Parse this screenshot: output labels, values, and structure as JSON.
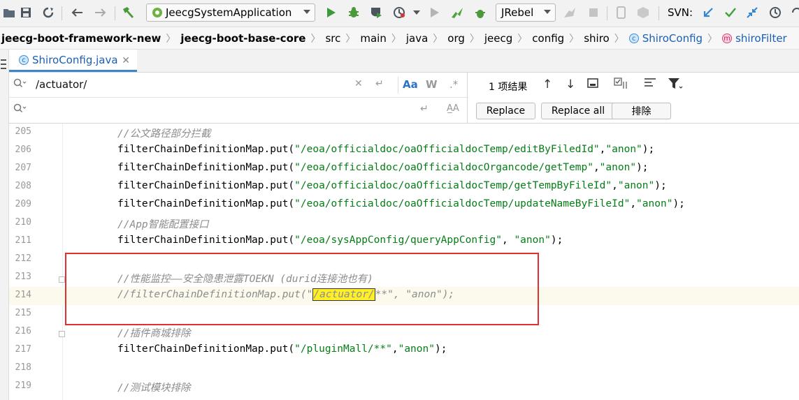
{
  "toolbar": {
    "run_config": "JeecgSystemApplication",
    "jrebel": "JRebel",
    "svn_label": "SVN:"
  },
  "breadcrumb": [
    "jeecg-boot-framework-new",
    "jeecg-boot-base-core",
    "src",
    "main",
    "java",
    "org",
    "jeecg",
    "config",
    "shiro",
    "ShiroConfig",
    "shiroFilter"
  ],
  "tab": {
    "label": "ShiroConfig.java"
  },
  "find": {
    "search_value": "/actuator/",
    "replace_value": "",
    "match_case": "Aa",
    "words": "W",
    "regex": ".*",
    "preserve_case": "A̲A",
    "result_count": "1 项结果",
    "replace_btn": "Replace",
    "replace_all_btn": "Replace all",
    "exclude_btn": "排除"
  },
  "editor": {
    "lines": [
      {
        "no": "205",
        "pre": "",
        "str": "",
        "post": "",
        "comment": "//公文路径部分拦截"
      },
      {
        "no": "206",
        "pre": "filterChainDefinitionMap.put(",
        "str": "\"/eoa/officialdoc/oaOfficialdocTemp/editByFiledId\"",
        "mid": ",",
        "str2": "\"anon\"",
        "post": ");"
      },
      {
        "no": "207",
        "pre": "filterChainDefinitionMap.put(",
        "str": "\"/eoa/officialdoc/oaOfficialdocOrgancode/getTemp\"",
        "mid": ",",
        "str2": "\"anon\"",
        "post": ");"
      },
      {
        "no": "208",
        "pre": "filterChainDefinitionMap.put(",
        "str": "\"/eoa/officialdoc/oaOfficialdocTemp/getTempByFileId\"",
        "mid": ",",
        "str2": "\"anon\"",
        "post": ");"
      },
      {
        "no": "209",
        "pre": "filterChainDefinitionMap.put(",
        "str": "\"/eoa/officialdoc/oaOfficialdocTemp/updateNameByFileId\"",
        "mid": ",",
        "str2": "\"anon\"",
        "post": ");"
      },
      {
        "no": "210",
        "comment": "//App智能配置接口"
      },
      {
        "no": "211",
        "pre": "filterChainDefinitionMap.put(",
        "str": "\"/eoa/sysAppConfig/queryAppConfig\"",
        "mid": ", ",
        "str2": "\"anon\"",
        "post": ");"
      },
      {
        "no": "212"
      },
      {
        "no": "213",
        "comment": "//性能监控——安全隐患泄露TOEKN (durid连接池也有)"
      },
      {
        "no": "214",
        "c_pre": "//filterChainDefinitionMap.put(\"",
        "c_hl": "/actuator/",
        "c_post": "**\", \"anon\");"
      },
      {
        "no": "215"
      },
      {
        "no": "216",
        "comment": "//插件商城排除"
      },
      {
        "no": "217",
        "pre": "filterChainDefinitionMap.put(",
        "str": "\"/pluginMall/**\"",
        "mid": ",",
        "str2": "\"anon\"",
        "post": ");"
      },
      {
        "no": "218"
      },
      {
        "no": "219",
        "comment": "//测试模块排除"
      }
    ]
  }
}
